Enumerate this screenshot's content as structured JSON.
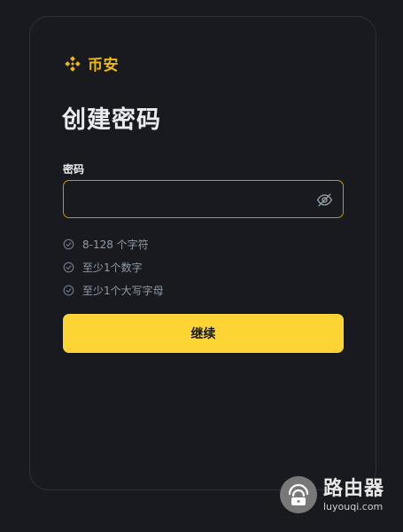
{
  "brand": {
    "name": "币安",
    "color": "#f0b90b"
  },
  "title": "创建密码",
  "password_field": {
    "label": "密码",
    "value": "",
    "visibility_icon": "eye-off-icon"
  },
  "requirements": [
    {
      "text": "8-128 个字符",
      "icon": "check-circle-icon"
    },
    {
      "text": "至少1个数字",
      "icon": "check-circle-icon"
    },
    {
      "text": "至少1个大写字母",
      "icon": "check-circle-icon"
    }
  ],
  "continue_button": {
    "label": "继续",
    "color": "#fcd535"
  },
  "watermark": {
    "title": "路由器",
    "url": "luyouqi.com"
  }
}
